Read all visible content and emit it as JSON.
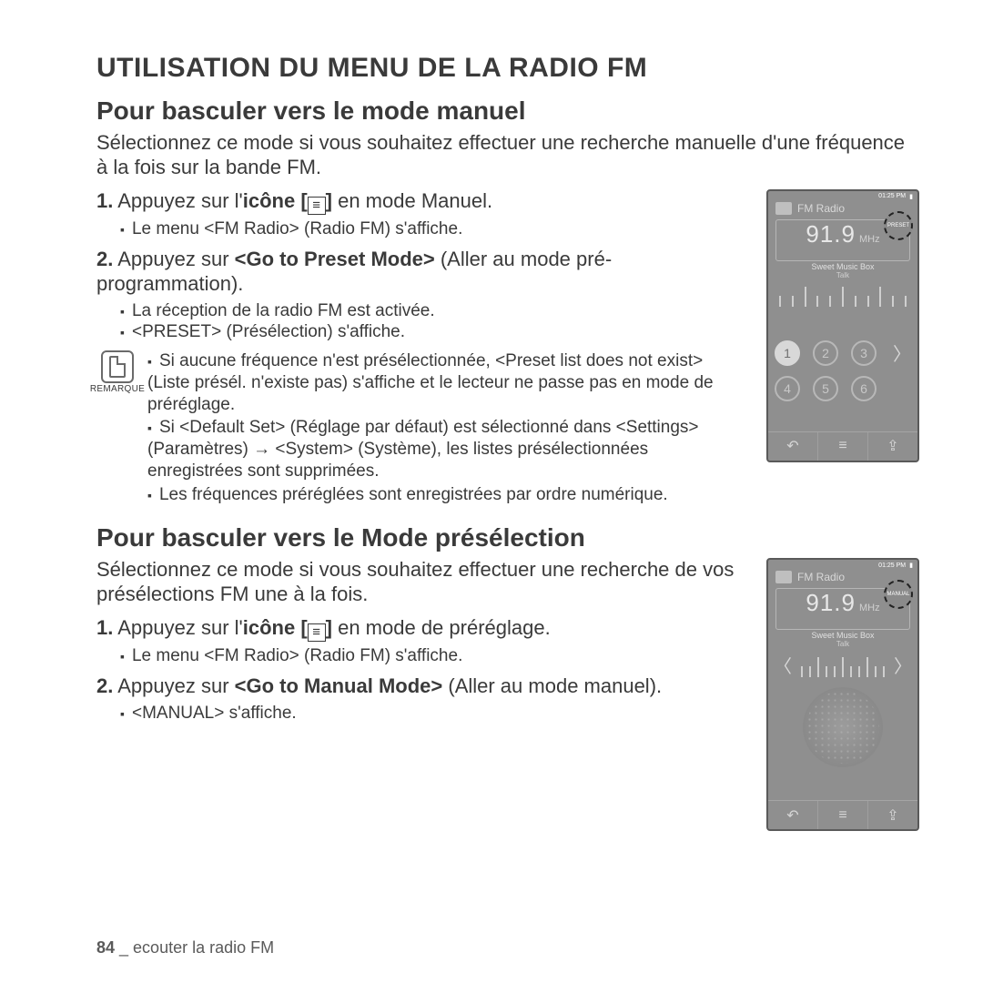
{
  "title": "UTILISATION DU MENU DE LA RADIO FM",
  "sec1": {
    "heading": "Pour basculer vers le mode manuel",
    "intro": "Sélectionnez ce mode si vous souhaitez effectuer une recherche manuelle d'une fréquence à la fois sur la bande FM.",
    "step1_num": "1.",
    "step1_a": " Appuyez sur l'",
    "step1_b": "icône [",
    "step1_c": "]",
    "step1_d": " en mode Manuel.",
    "step1_sub": "Le menu <FM Radio> (Radio FM) s'affiche.",
    "step2_num": "2.",
    "step2_a": " Appuyez sur ",
    "step2_b": "<Go to Preset Mode>",
    "step2_c": " (Aller au mode pré-programmation).",
    "step2_sub1": "La réception de la radio FM est activée.",
    "step2_sub2": "<PRESET> (Présélection) s'affiche.",
    "remark_label": "REMARQUE",
    "remarks": {
      "r1": "Si aucune fréquence n'est présélectionnée, <Preset list does not exist> (Liste présél. n'existe pas) s'affiche et le lecteur ne passe pas en mode de préréglage.",
      "r2": "Si <Default Set> (Réglage par défaut) est sélectionné dans <Settings> (Paramètres) → <System> (Système), les listes présélectionnées enregistrées sont supprimées.",
      "r3": "Les fréquences préréglées sont enregistrées par ordre numérique."
    }
  },
  "sec2": {
    "heading": "Pour basculer vers le Mode présélection",
    "intro1": "Sélectionnez ce mode si vous souhaitez effectuer une recherche de vos",
    "intro2": "présélections FM une à la fois.",
    "step1_num": "1.",
    "step1_a": " Appuyez sur l'",
    "step1_b": "icône [",
    "step1_c": "]",
    "step1_d": " en mode de préréglage.",
    "step1_sub": "Le menu <FM Radio> (Radio FM) s'affiche.",
    "step2_num": "2.",
    "step2_a": " Appuyez sur ",
    "step2_b": "<Go to Manual Mode>",
    "step2_c": " (Aller au mode manuel).",
    "step2_sub": "<MANUAL> s'affiche."
  },
  "phone": {
    "time": "01:25 PM",
    "title": "FM Radio",
    "freq": "91.9",
    "mhz": "MHz",
    "song": "Sweet Music Box",
    "sub": "Talk",
    "badge_preset": "PRESET",
    "badge_manual": "MANUAL",
    "p1": "1",
    "p2": "2",
    "p3": "3",
    "p4": "4",
    "p5": "5",
    "p6": "6",
    "back": "↶",
    "menu": "≡",
    "share": "⇪"
  },
  "footer": {
    "page": "84",
    "sep": " _ ",
    "chapter": "ecouter la radio FM"
  }
}
